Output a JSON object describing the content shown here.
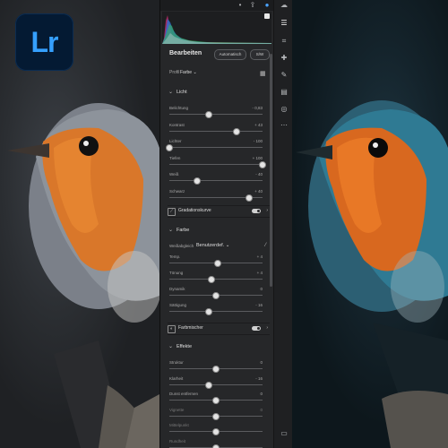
{
  "app": {
    "logo_text": "Lr"
  },
  "panel": {
    "title": "Bearbeiten",
    "auto_button": "Automatisch",
    "bw_button": "S/W",
    "profile_label": "Profil",
    "profile_value": "Farbe"
  },
  "sections": {
    "licht": {
      "title": "Licht"
    },
    "farbe": {
      "title": "Farbe"
    },
    "effekte": {
      "title": "Effekte"
    }
  },
  "licht_sliders": [
    {
      "name": "Belichtung",
      "value": "- 0,83",
      "fraction": 0.42
    },
    {
      "name": "Kontrast",
      "value": "+ 43",
      "fraction": 0.72
    },
    {
      "name": "Lichter",
      "value": "- 100",
      "fraction": 0.0
    },
    {
      "name": "Tiefen",
      "value": "+ 100",
      "fraction": 1.0
    },
    {
      "name": "Weiß",
      "value": "- 40",
      "fraction": 0.3
    },
    {
      "name": "Schwarz",
      "value": "+ 40",
      "fraction": 0.86
    }
  ],
  "toggles": {
    "gradation": "Gradationskurve",
    "farbmischer": "Farbmischer"
  },
  "farbe": {
    "wb_label": "Weißabgleich",
    "wb_value": "Benutzerdef."
  },
  "farbe_sliders": [
    {
      "name": "Temp.",
      "value": "+ 4",
      "fraction": 0.52
    },
    {
      "name": "Tönung",
      "value": "+ 4",
      "fraction": 0.45
    },
    {
      "name": "Dynamik",
      "value": "0",
      "fraction": 0.5
    },
    {
      "name": "Sättigung",
      "value": "- 16",
      "fraction": 0.42
    }
  ],
  "effekte_sliders": [
    {
      "name": "Struktur",
      "value": "0",
      "fraction": 0.5
    },
    {
      "name": "Klarheit",
      "value": "- 16",
      "fraction": 0.42
    },
    {
      "name": "Dunst entfernen",
      "value": "0",
      "fraction": 0.5
    },
    {
      "name": "Vignette",
      "value": "0",
      "fraction": 0.5
    },
    {
      "name": "Mittelpunkt",
      "value": "",
      "fraction": 0.5
    },
    {
      "name": "Rundheit",
      "value": "",
      "fraction": 0.5
    }
  ],
  "colors": {
    "panel_bg": "#262729",
    "accent_blue": "#35a0ff",
    "logo_bg": "#041a33"
  },
  "icons": {
    "tools": [
      "sliders-icon",
      "crop-icon",
      "healing-icon",
      "brush-icon",
      "gradient-icon",
      "radial-icon",
      "more-icon"
    ],
    "topbar": [
      "help-icon",
      "share-icon",
      "profile-icon",
      "cloud-icon"
    ]
  }
}
